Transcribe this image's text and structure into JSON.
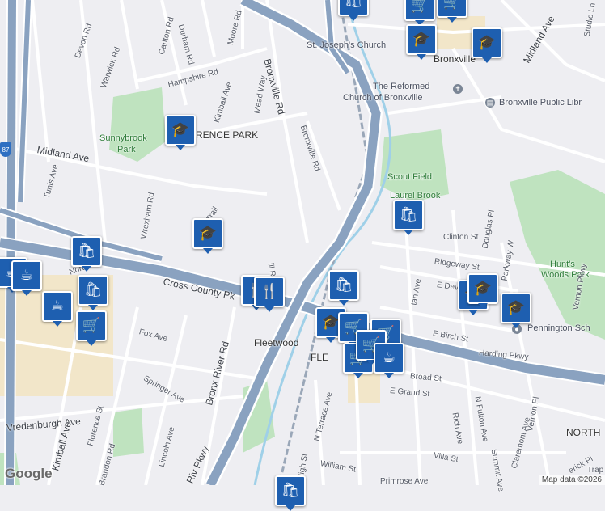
{
  "map": {
    "colors": {
      "background": "#eeeef2",
      "park": "#bfe3bf",
      "commercial": "#f2e6c9",
      "highway": "#8aa2c0",
      "highway_casing": "#ffffff",
      "road": "#ffffff",
      "rail": "#9aa7b8",
      "water": "#9fd0e8",
      "marker": "#1e5fb0"
    },
    "places": {
      "bronxville": "Bronxville",
      "lawrence_park": "RENCE PARK",
      "fleetwood": "Fleetwood",
      "fleetwood_area": "FLE",
      "north": "NORTH"
    },
    "parks": {
      "sunnybrook_1": "Sunnybrook",
      "sunnybrook_2": "Park",
      "scout_field": "Scout Field",
      "laurel_brook": "Laurel Brook",
      "hunts_1": "Hunt's",
      "hunts_2": "Woods Park"
    },
    "pois": {
      "st_josephs": "St. Joseph's Church",
      "reformed_1": "The Reformed",
      "reformed_2": "Church of Bronxville",
      "library": "Bronxville Public Libr",
      "pennington": "Pennington Sch"
    },
    "streets": {
      "devon": "Devon Rd",
      "durham": "Durham Rd",
      "carlton": "Carlton Rd",
      "warwick": "Warwick Rd",
      "moore": "Moore Rd",
      "hampshire": "Hampshire Rd",
      "kimball_n": "Kimball Ave",
      "mead": "Mead Way",
      "bronxville_rd_1": "Bronxville Rd",
      "bronxville_rd_2": "Bronxville Rd",
      "midland_w": "Midland Ave",
      "midland_e": "Midland Ave",
      "studio": "Studio Ln",
      "tunis": "Tunis Ave",
      "wrexham": "Wrexham Rd",
      "trail": "Trail",
      "clinton": "Clinton St",
      "douglas": "Douglas Pl",
      "parkway_w": "Parkway W",
      "ridgeway": "Ridgeway St",
      "vernon_pkwy": "Vernon Pkwy",
      "devon_e": "E Devon",
      "pelham": "tan Ave",
      "cross_county": "Cross County Pk",
      "hill": "ill Rd",
      "fox": "Fox Ave",
      "springer": "Springer Ave",
      "bronx_river": "Bronx River Rd",
      "e_birch": "E Birch St",
      "harding": "Harding Pkwy",
      "vredenburgh": "Vredenburgh Ave",
      "florence": "Florence St",
      "kimball_s": "Kimball Ave",
      "lincoln": "Lincoln Ave",
      "brandon": "Brandon Rd",
      "bronx_river_pkwy": "Riv Pkwy",
      "n_terrace": "N Terrace Ave",
      "high": "High St",
      "william": "William St",
      "broad": "Broad St",
      "e_grand": "E Grand St",
      "rich": "Rich Ave",
      "n_fulton": "N Fulton Ave",
      "summit": "Summit Ave",
      "vernon_pl": "Vernon Pl",
      "claremont": "Claremont Ave",
      "villa": "Villa St",
      "primrose": "Primrose Ave",
      "yerick": "erick Pl",
      "trap": "Trap",
      "north_ave": "Nort"
    },
    "highway_shield": "87",
    "logo": "Google",
    "attribution": "Map data ©2026"
  },
  "markers": [
    {
      "type": "shopping",
      "glyph": "🛍"
    },
    {
      "type": "shopping",
      "glyph": "🛒"
    },
    {
      "type": "shopping",
      "glyph": "🛒"
    },
    {
      "type": "school",
      "glyph": "🎓"
    },
    {
      "type": "school",
      "glyph": "🎓"
    },
    {
      "type": "school",
      "glyph": "🎓"
    },
    {
      "type": "school",
      "glyph": "🎓"
    },
    {
      "type": "shopping",
      "glyph": "🛍"
    },
    {
      "type": "shopping",
      "glyph": "🛍"
    },
    {
      "type": "cafe",
      "glyph": "☕"
    },
    {
      "type": "cafe",
      "glyph": "☕"
    },
    {
      "type": "shopping",
      "glyph": "🛍"
    },
    {
      "type": "cafe",
      "glyph": "☕"
    },
    {
      "type": "shopping",
      "glyph": "🛒"
    },
    {
      "type": "restaurant",
      "glyph": "🍴"
    },
    {
      "type": "restaurant",
      "glyph": "🍴"
    },
    {
      "type": "shopping",
      "glyph": "🛍"
    },
    {
      "type": "school",
      "glyph": "🎓"
    },
    {
      "type": "school",
      "glyph": "🎓"
    },
    {
      "type": "school",
      "glyph": "🎓"
    },
    {
      "type": "school",
      "glyph": "🎓"
    },
    {
      "type": "shopping",
      "glyph": "🛒"
    },
    {
      "type": "shopping",
      "glyph": "🛒"
    },
    {
      "type": "shopping",
      "glyph": "🛒"
    },
    {
      "type": "shopping",
      "glyph": "🛒"
    },
    {
      "type": "cafe",
      "glyph": "☕"
    },
    {
      "type": "shopping",
      "glyph": "🛍"
    }
  ]
}
